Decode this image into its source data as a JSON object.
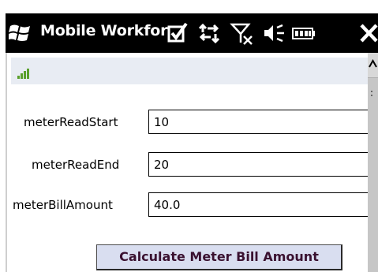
{
  "titlebar": {
    "title": "Mobile Workfor",
    "icons": [
      "windows-logo-icon",
      "checkbox-checked-icon",
      "connectivity-arrows-icon",
      "no-signal-icon",
      "speaker-icon",
      "battery-icon",
      "close-icon"
    ]
  },
  "status": {
    "icon": "signal-strength-icon"
  },
  "form": {
    "fields": [
      {
        "label": "meterReadStart",
        "value": "10"
      },
      {
        "label": "meterReadEnd",
        "value": "20"
      },
      {
        "label": "meterBillAmount",
        "value": "40.0"
      }
    ],
    "button_label": "Calculate Meter Bill Amount"
  },
  "colors": {
    "titlebar_bg": "#000000",
    "status_strip_bg": "#e8ecf3",
    "button_bg": "#d9def0",
    "button_text": "#3a1130",
    "signal_green": "#5aa02c"
  }
}
